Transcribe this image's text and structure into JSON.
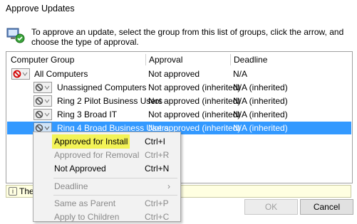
{
  "window": {
    "title": "Approve Updates"
  },
  "instructions": "To approve an update, select the group from this list of groups, click the arrow, and choose the type of approval.",
  "grid": {
    "columns": [
      "Computer Group",
      "Approval",
      "Deadline"
    ],
    "rows": [
      {
        "name": "All Computers",
        "approval": "Not approved",
        "deadline": "N/A",
        "level": 0,
        "icon": "not-approved-icon"
      },
      {
        "name": "Unassigned Computers",
        "approval": "Not approved (inherited)",
        "deadline": "N/A (inherited)",
        "level": 1,
        "icon": "not-approved-inherited-icon"
      },
      {
        "name": "Ring 2 Pilot Business Users",
        "approval": "Not approved (inherited)",
        "deadline": "N/A (inherited)",
        "level": 1,
        "icon": "not-approved-inherited-icon"
      },
      {
        "name": "Ring 3 Broad IT",
        "approval": "Not approved (inherited)",
        "deadline": "N/A (inherited)",
        "level": 1,
        "icon": "not-approved-inherited-icon"
      },
      {
        "name": "Ring 4 Broad Business Users",
        "approval": "Not approved (inherited)",
        "deadline": "N/A (inherited)",
        "level": 1,
        "icon": "not-approved-inherited-icon",
        "selected": true
      }
    ]
  },
  "context_menu": {
    "items": [
      {
        "label": "Approved for Install",
        "shortcut": "Ctrl+I",
        "enabled": true,
        "highlighted": true
      },
      {
        "label": "Approved for Removal",
        "shortcut": "Ctrl+R",
        "enabled": false
      },
      {
        "label": "Not Approved",
        "shortcut": "Ctrl+N",
        "enabled": true
      },
      {
        "label": "Deadline",
        "shortcut": "",
        "enabled": false,
        "submenu": true
      },
      {
        "label": "Same as Parent",
        "shortcut": "Ctrl+P",
        "enabled": false
      },
      {
        "label": "Apply to Children",
        "shortcut": "Ctrl+C",
        "enabled": false
      }
    ],
    "submenu_arrow": "›"
  },
  "infobar": {
    "text": "The",
    "icon": "info-icon",
    "icon_glyph": "i"
  },
  "buttons": {
    "ok": "OK",
    "cancel": "Cancel"
  },
  "colors": {
    "selection": "#3399ff",
    "highlight": "#f3f356",
    "info_bg": "#ffffe1",
    "not_approved_red": "#d40000"
  }
}
